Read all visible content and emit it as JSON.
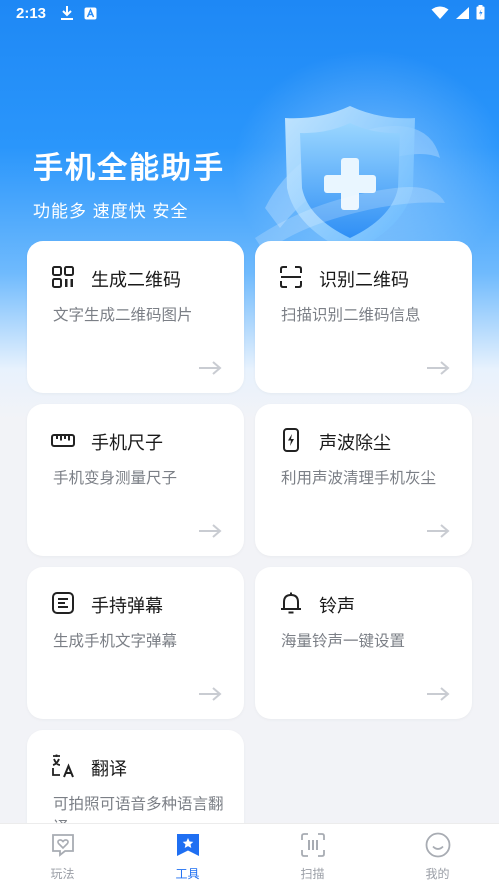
{
  "status_bar": {
    "time": "2:13"
  },
  "hero": {
    "title": "手机全能助手",
    "subtitle": "功能多 速度快  安全"
  },
  "cards": [
    {
      "title": "生成二维码",
      "desc": "文字生成二维码图片",
      "icon": "qr-code-icon"
    },
    {
      "title": "识别二维码",
      "desc": "扫描识别二维码信息",
      "icon": "scan-frame-icon"
    },
    {
      "title": "手机尺子",
      "desc": "手机变身测量尺子",
      "icon": "ruler-icon"
    },
    {
      "title": "声波除尘",
      "desc": "利用声波清理手机灰尘",
      "icon": "phone-bolt-icon"
    },
    {
      "title": "手持弹幕",
      "desc": "生成手机文字弹幕",
      "icon": "text-box-icon"
    },
    {
      "title": "铃声",
      "desc": "海量铃声一键设置",
      "icon": "bell-icon"
    },
    {
      "title": "翻译",
      "desc": "可拍照可语音多种语言翻译",
      "icon": "translate-icon"
    }
  ],
  "tabbar": {
    "items": [
      {
        "label": "玩法",
        "icon": "heart-chat-icon",
        "active": false
      },
      {
        "label": "工具",
        "icon": "star-bookmark-icon",
        "active": true
      },
      {
        "label": "扫描",
        "icon": "scan-bars-icon",
        "active": false
      },
      {
        "label": "我的",
        "icon": "smile-icon",
        "active": false
      }
    ],
    "active_color": "#1f6ff2",
    "inactive_color": "#9a9ea6"
  },
  "colors": {
    "hero_blue": "#1e88f5",
    "background": "#f2f3f7"
  }
}
